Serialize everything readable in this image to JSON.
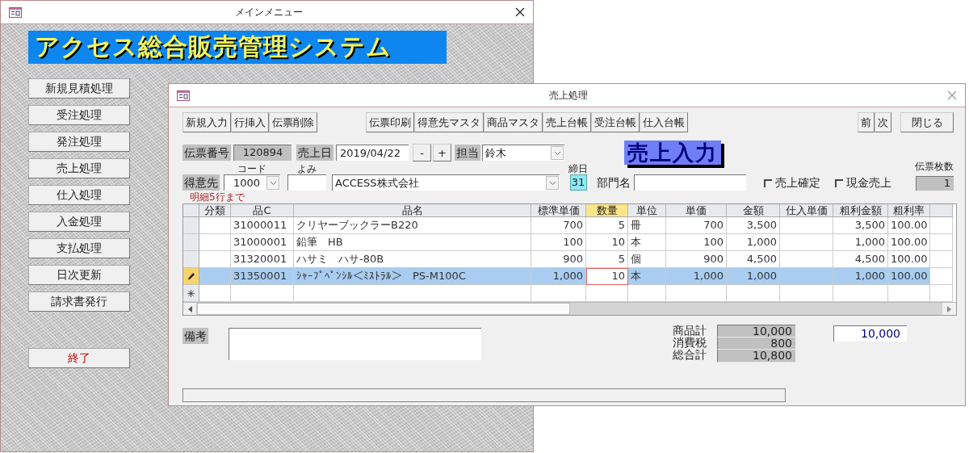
{
  "main_window": {
    "title": "メインメニュー",
    "banner": "アクセス総合販売管理システム",
    "menu_buttons": [
      "新規見積処理",
      "受注処理",
      "発注処理",
      "売上処理",
      "仕入処理",
      "入金処理",
      "支払処理",
      "日次更新",
      "請求書発行"
    ],
    "exit_button": "終了"
  },
  "sales_dialog": {
    "title": "売上処理",
    "toolbar_left": [
      "新規入力",
      "行挿入",
      "伝票削除"
    ],
    "toolbar_middle": [
      "伝票印刷",
      "得意先マスタ",
      "商品マスタ",
      "売上台帳",
      "受注台帳",
      "仕入台帳"
    ],
    "nav_buttons": [
      "前",
      "次"
    ],
    "close_button": "閉じる",
    "slip_number": {
      "label": "伝票番号",
      "value": "120894"
    },
    "sales_date": {
      "label": "売上日",
      "value": "2019/04/22"
    },
    "date_buttons": [
      "-",
      "+"
    ],
    "staff": {
      "label": "担当",
      "value": "鈴木"
    },
    "form_title": "売上入力",
    "customer": {
      "label": "得意先",
      "code_label": "コード",
      "code": "1000",
      "reading_label": "よみ",
      "name": "ACCESS株式会社"
    },
    "closing_day": {
      "label": "締日",
      "value": "31"
    },
    "department": {
      "label": "部門名"
    },
    "checkboxes": [
      {
        "label": "売上確定",
        "checked": false
      },
      {
        "label": "現金売上",
        "checked": false
      }
    ],
    "slip_count": {
      "label": "伝票枚数",
      "value": "1"
    },
    "detail_note": "明細5行まで",
    "grid": {
      "columns": [
        {
          "label": "分類",
          "current": false
        },
        {
          "label": "品C",
          "current": false
        },
        {
          "label": "品名",
          "current": false
        },
        {
          "label": "標準単価",
          "current": false
        },
        {
          "label": "数量",
          "current": true
        },
        {
          "label": "単位",
          "current": false
        },
        {
          "label": "単価",
          "current": false
        },
        {
          "label": "金額",
          "current": false
        },
        {
          "label": "仕入単価",
          "current": false
        },
        {
          "label": "粗利金額",
          "current": false
        },
        {
          "label": "粗利率",
          "current": false
        }
      ],
      "rows": [
        {
          "kind": "record",
          "selected": false,
          "editing": false,
          "cells": [
            null,
            "31000011",
            "クリヤーブックラーB220",
            "700",
            "5",
            "冊",
            "700",
            "3,500",
            null,
            "3,500",
            "100.00"
          ]
        },
        {
          "kind": "record",
          "selected": false,
          "editing": false,
          "cells": [
            null,
            "31000001",
            "鉛筆　HB",
            "100",
            "10",
            "本",
            "100",
            "1,000",
            null,
            "1,000",
            "100.00"
          ]
        },
        {
          "kind": "record",
          "selected": false,
          "editing": false,
          "cells": [
            null,
            "31320001",
            "ハサミ　ハサ-80B",
            "900",
            "5",
            "個",
            "900",
            "4,500",
            null,
            "4,500",
            "100.00"
          ]
        },
        {
          "kind": "record",
          "selected": true,
          "editing": true,
          "cells": [
            null,
            "31350001",
            "ｼｬｰﾌﾟﾍﾟﾝｼﾙ＜ﾐｽﾄﾗﾙ＞　PS-M100C",
            "1,000",
            "10",
            "本",
            "1,000",
            "1,000",
            null,
            "1,000",
            "100.00"
          ]
        },
        {
          "kind": "new",
          "selected": false,
          "editing": false
        }
      ]
    },
    "remarks": {
      "label": "備考"
    },
    "totals": [
      {
        "label": "商品計",
        "value": "10,000"
      },
      {
        "label": "消費税",
        "value": "800"
      },
      {
        "label": "総合計",
        "value": "10,800"
      }
    ],
    "total_field": "10,000"
  }
}
